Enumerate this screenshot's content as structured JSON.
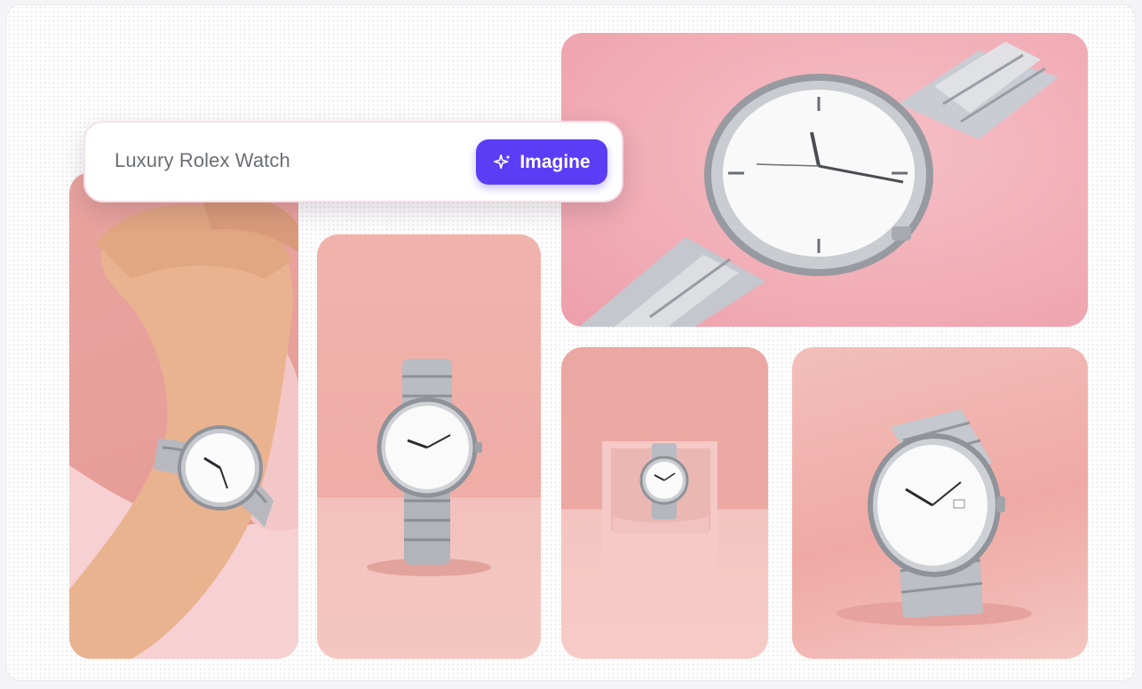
{
  "search": {
    "query": "Luxury Rolex Watch",
    "button_label": "Imagine",
    "button_icon": "sparkle-icon"
  },
  "gallery": {
    "images": [
      {
        "id": "wrist",
        "subject": "watch-on-wrist-image"
      },
      {
        "id": "standing",
        "subject": "standing-watch-image"
      },
      {
        "id": "closeup",
        "subject": "watch-closeup-image"
      },
      {
        "id": "box",
        "subject": "watch-in-box-image"
      },
      {
        "id": "angled",
        "subject": "angled-watch-image"
      }
    ]
  },
  "colors": {
    "accent": "#5b3df5",
    "background": "#ffffff",
    "tile_pink": "#eeada6"
  }
}
